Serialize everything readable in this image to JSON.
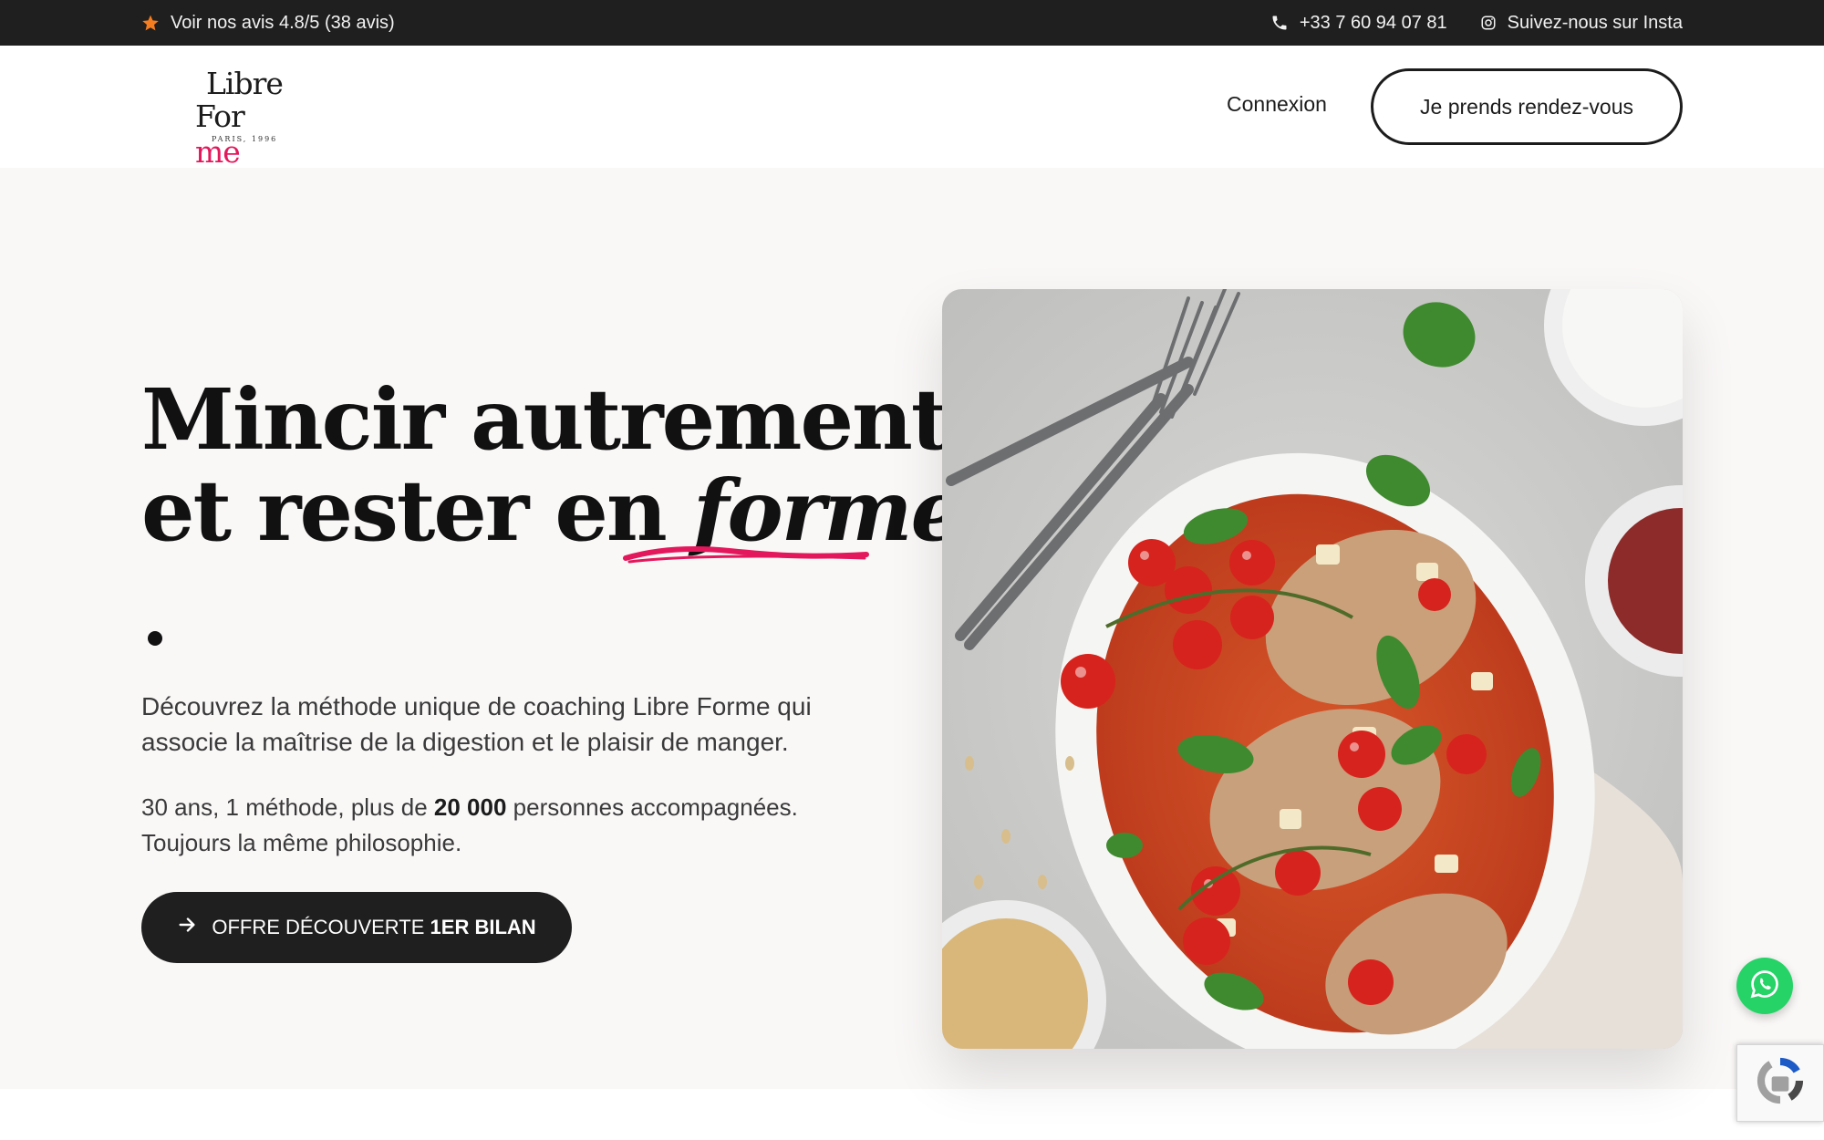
{
  "topbar": {
    "reviews_text": "Voir nos avis 4.8/5 (38 avis)",
    "phone": "+33 7 60 94 07 81",
    "instagram": "Suivez-nous sur Insta",
    "star_color": "#f57c1f"
  },
  "header": {
    "logo": {
      "line1": "Libre",
      "line2_a": "For",
      "line2_b": "me",
      "line3": "PARIS, 1996"
    },
    "login_label": "Connexion",
    "rdv_label": "Je prends rendez-vous"
  },
  "hero": {
    "title_line1": "Mincir autrement,",
    "title_line2_prefix": "et rester en ",
    "title_line2_italic": "forme",
    "underline_color": "#e3185c",
    "paragraph1": "Découvrez la méthode unique de coaching Libre Forme qui associe la maîtrise de la digestion et le plaisir de manger.",
    "paragraph2_prefix": "30 ans, 1 méthode, plus de ",
    "paragraph2_bold": "20 000",
    "paragraph2_suffix": " personnes accompagnées.",
    "paragraph2_line2": "Toujours la même philosophie.",
    "cta_prefix": "OFFRE DÉCOUVERTE ",
    "cta_bold": "1ER BILAN",
    "cta_icon": "arrow-right-icon",
    "image": "baked-chicken-with-cherry-tomatoes-basil"
  },
  "widgets": {
    "whatsapp_color": "#25d366",
    "whatsapp_icon": "whatsapp-icon",
    "recaptcha_icon": "recaptcha-icon"
  }
}
